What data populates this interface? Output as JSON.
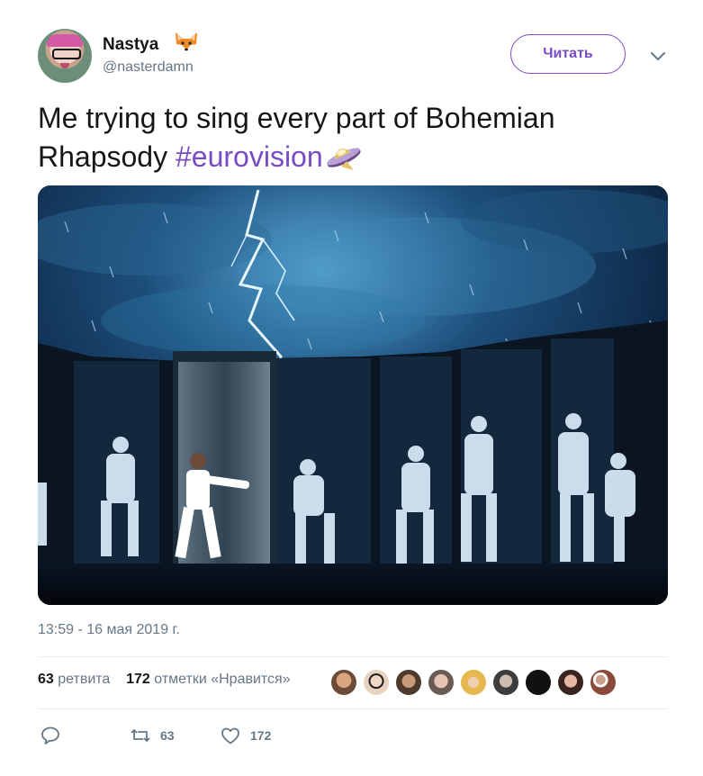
{
  "tweet": {
    "author_name": "Nastya",
    "author_emoji": "fox-face",
    "author_handle": "@nasterdamn",
    "follow_label": "Читать",
    "text_plain": "Me trying to sing every part of Bohemian Rhapsody ",
    "hashtag": "#eurovision",
    "text_emoji": "flying-saucer",
    "timestamp": "13:59 - 16 мая 2019 г.",
    "image_alt": "Singer on stage in a glass box surrounded by projected copies under a lightning sky"
  },
  "stats": {
    "retweets_count": "63",
    "retweets_label": "ретвита",
    "likes_count": "172",
    "likes_label": "отметки «Нравится»"
  },
  "likers": [
    "liker-avatar-1",
    "liker-avatar-2",
    "liker-avatar-3",
    "liker-avatar-4",
    "liker-avatar-5",
    "liker-avatar-6",
    "liker-avatar-7",
    "liker-avatar-8",
    "liker-avatar-9"
  ],
  "actions": {
    "reply_icon": "reply-icon",
    "retweet_count": "63",
    "like_count": "172"
  },
  "colors": {
    "accent": "#794bc4",
    "secondary_text": "#657786",
    "divider": "#e6ecf0"
  }
}
